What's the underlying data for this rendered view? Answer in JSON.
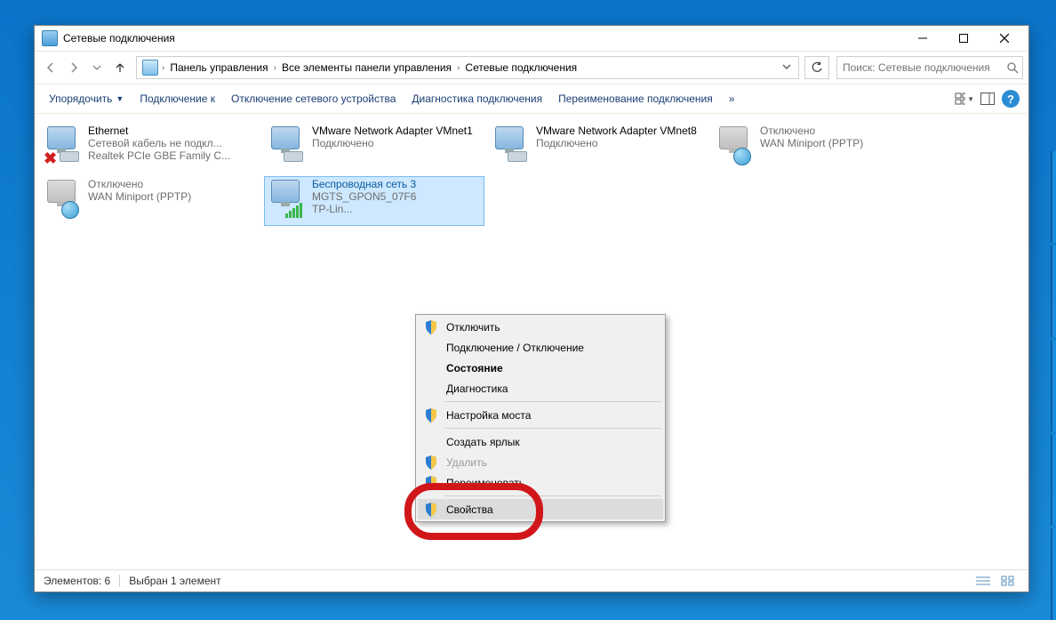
{
  "window": {
    "title": "Сетевые подключения"
  },
  "breadcrumb": {
    "items": [
      "Панель управления",
      "Все элементы панели управления",
      "Сетевые подключения"
    ]
  },
  "search": {
    "placeholder": "Поиск: Сетевые подключения"
  },
  "toolbar": {
    "organize": "Упорядочить",
    "connect": "Подключение к",
    "disable": "Отключение сетевого устройства",
    "diagnose": "Диагностика подключения",
    "rename": "Переименование подключения",
    "more": "»"
  },
  "connections": [
    {
      "name": "Ethernet",
      "line2": "Сетевой кабель не подкл...",
      "line3": "Realtek PCIe GBE Family C...",
      "kind": "cable-unplugged",
      "selected": false
    },
    {
      "name": "VMware Network Adapter VMnet1",
      "line2": "",
      "line3": "Подключено",
      "kind": "connected",
      "selected": false
    },
    {
      "name": "VMware Network Adapter VMnet8",
      "line2": "",
      "line3": "Подключено",
      "kind": "connected",
      "selected": false
    },
    {
      "name": "",
      "line2": "Отключено",
      "line3": "WAN Miniport (PPTP)",
      "kind": "disabled",
      "selected": false
    },
    {
      "name": "",
      "line2": "Отключено",
      "line3": "WAN Miniport (PPTP)",
      "kind": "disabled",
      "selected": false
    },
    {
      "name": "Беспроводная сеть 3",
      "line2": "MGTS_GPON5_07F6",
      "line3": "TP-Lin...",
      "kind": "wifi",
      "selected": true
    }
  ],
  "contextmenu": {
    "items": [
      {
        "label": "Отключить",
        "shield": true
      },
      {
        "label": "Подключение / Отключение"
      },
      {
        "label": "Состояние",
        "bold": true
      },
      {
        "label": "Диагностика"
      },
      {
        "sep": true
      },
      {
        "label": "Настройка моста",
        "shield": true
      },
      {
        "sep": true
      },
      {
        "label": "Создать ярлык"
      },
      {
        "label": "Удалить",
        "shield": true,
        "disabled": true
      },
      {
        "label": "Переименовать",
        "shield": true
      },
      {
        "sep": true
      },
      {
        "label": "Свойства",
        "shield": true,
        "hover": true
      }
    ]
  },
  "statusbar": {
    "count": "Элементов: 6",
    "selected": "Выбран 1 элемент"
  }
}
